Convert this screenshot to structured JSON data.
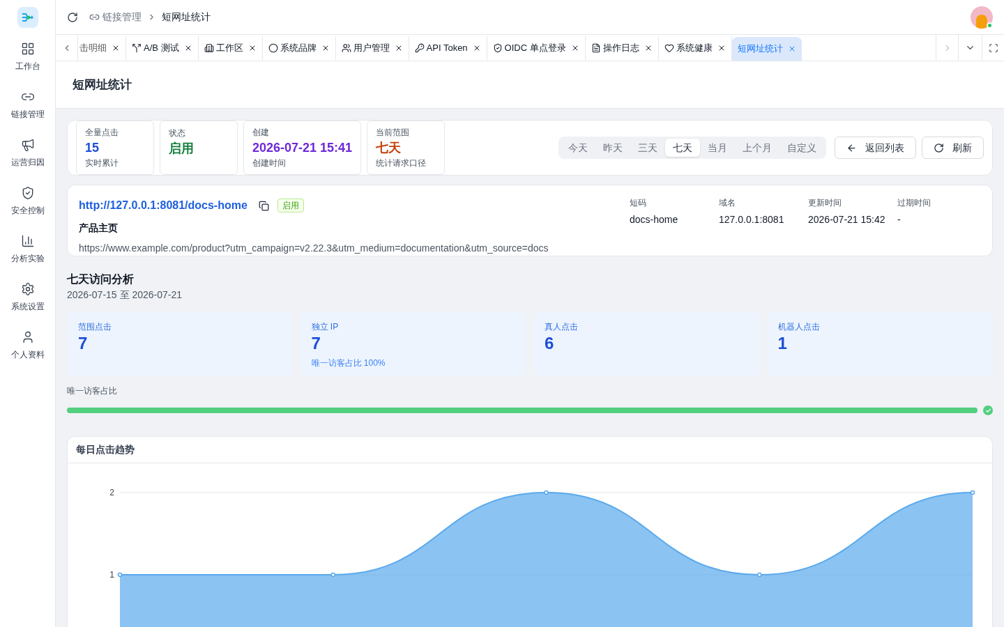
{
  "sidebar": {
    "items": [
      {
        "label": "工作台"
      },
      {
        "label": "链接管理"
      },
      {
        "label": "运营归因"
      },
      {
        "label": "安全控制"
      },
      {
        "label": "分析实验"
      },
      {
        "label": "系统设置"
      },
      {
        "label": "个人资料"
      }
    ]
  },
  "breadcrumb": [
    "链接管理",
    "短网址统计"
  ],
  "tabs": [
    {
      "label": "击明细",
      "selected": false
    },
    {
      "label": "A/B 测试",
      "selected": false
    },
    {
      "label": "工作区",
      "selected": false
    },
    {
      "label": "系统品牌",
      "selected": false
    },
    {
      "label": "用户管理",
      "selected": false
    },
    {
      "label": "API Token",
      "selected": false
    },
    {
      "label": "OIDC 单点登录",
      "selected": false
    },
    {
      "label": "操作日志",
      "selected": false
    },
    {
      "label": "系统健康",
      "selected": false
    },
    {
      "label": "短网址统计",
      "selected": true
    }
  ],
  "page_title": "短网址统计",
  "summary": [
    {
      "label": "全量点击",
      "value": "15",
      "note": "实时累计",
      "color": "#1d4ed8"
    },
    {
      "label": "状态",
      "value": "启用",
      "color": "#15803d"
    },
    {
      "label": "创建",
      "value": "2026-07-21 15:41",
      "note": "创建时间",
      "color": "#6d28d9"
    },
    {
      "label": "当前范围",
      "value": "七天",
      "note": "统计请求口径",
      "color": "#c2410c"
    }
  ],
  "ranges": [
    {
      "label": "今天",
      "selected": false
    },
    {
      "label": "昨天",
      "selected": false
    },
    {
      "label": "三天",
      "selected": false
    },
    {
      "label": "七天",
      "selected": true
    },
    {
      "label": "当月",
      "selected": false
    },
    {
      "label": "上个月",
      "selected": false
    },
    {
      "label": "自定义",
      "selected": false
    }
  ],
  "buttons": [
    "返回列表",
    "刷新"
  ],
  "link": {
    "short_url": "http://127.0.0.1:8081/docs-home",
    "status": "启用",
    "title": "产品主页",
    "target": "https://www.example.com/product?utm_campaign=v2.22.3&utm_medium=documentation&utm_source=docs",
    "fields": [
      {
        "label": "短码",
        "value": "docs-home"
      },
      {
        "label": "域名",
        "value": "127.0.0.1:8081"
      },
      {
        "label": "更新时间",
        "value": "2026-07-21 15:42"
      },
      {
        "label": "过期时间",
        "value": "-"
      }
    ]
  },
  "analysis": {
    "title": "七天访问分析",
    "range": "2026-07-15 至 2026-07-21",
    "stats": [
      {
        "label": "范围点击",
        "value": "7"
      },
      {
        "label": "独立 IP",
        "value": "7",
        "note": "唯一访客占比 100%"
      },
      {
        "label": "真人点击",
        "value": "6"
      },
      {
        "label": "机器人点击",
        "value": "1"
      }
    ],
    "unique_ratio": {
      "label": "唯一访客占比",
      "level": 1
    }
  },
  "trend": {
    "title": "每日点击趋势",
    "chart_data": {
      "type": "area",
      "ylim": [
        0,
        2
      ],
      "yticks": [
        1,
        2
      ],
      "series": [
        {
          "color": "#5aa9ec",
          "values": [
            1,
            1,
            2,
            1,
            2
          ]
        }
      ]
    }
  }
}
